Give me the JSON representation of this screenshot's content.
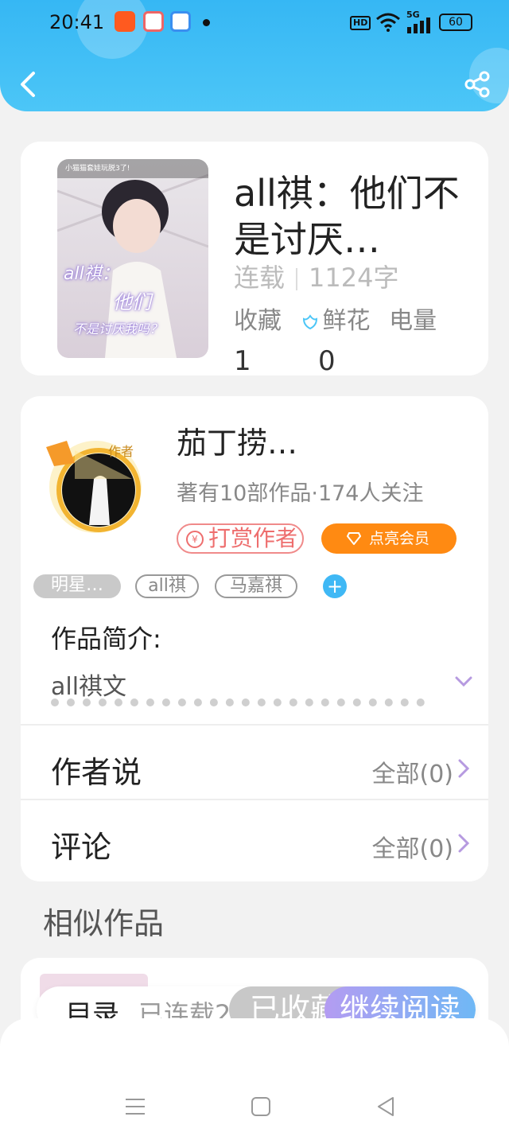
{
  "status_bar": {
    "time": "20:41",
    "network": "HD",
    "signal": "5G",
    "battery": "60"
  },
  "header": {
    "back_icon": "back-arrow-icon",
    "share_icon": "share-icon"
  },
  "book": {
    "cover_text_top": "小猫猫套娃玩脱3了!",
    "cover_text_overlay": [
      "all祺：",
      "他们",
      "不是讨厌我吗？"
    ],
    "title": "all祺：他们不是讨厌…",
    "status": "连载",
    "word_count": "1124字",
    "stats_labels": [
      "收藏",
      "鲜花",
      "电量"
    ],
    "stats_values": [
      "1",
      "0"
    ]
  },
  "author": {
    "badge": "作者",
    "name": "茄丁捞…",
    "meta": "著有10部作品·174人关注",
    "tip_label": "打赏作者",
    "vip_label": "点亮会员",
    "tags": [
      "明星…",
      "all祺",
      "马嘉祺"
    ],
    "intro_title": "作品简介:",
    "intro_text": "all祺文",
    "author_says_label": "作者说",
    "author_says_link": "全部(0)",
    "comments_label": "评论",
    "comments_link": "全部(0)"
  },
  "similar": {
    "title": "相似作品"
  },
  "bottom_bar": {
    "toc_label": "目录",
    "serial_label": "已连载2",
    "collected_label": "已收藏",
    "read_label": "继续阅读"
  },
  "nav": {
    "menu_icon": "menu-icon",
    "home_icon": "home-square-icon",
    "back_icon": "nav-back-icon"
  },
  "colors": {
    "header": "#36b7f4",
    "accent_orange": "#ff8a12",
    "tip_red": "#ee6e6e",
    "tag_blue": "#3fb8f5"
  }
}
